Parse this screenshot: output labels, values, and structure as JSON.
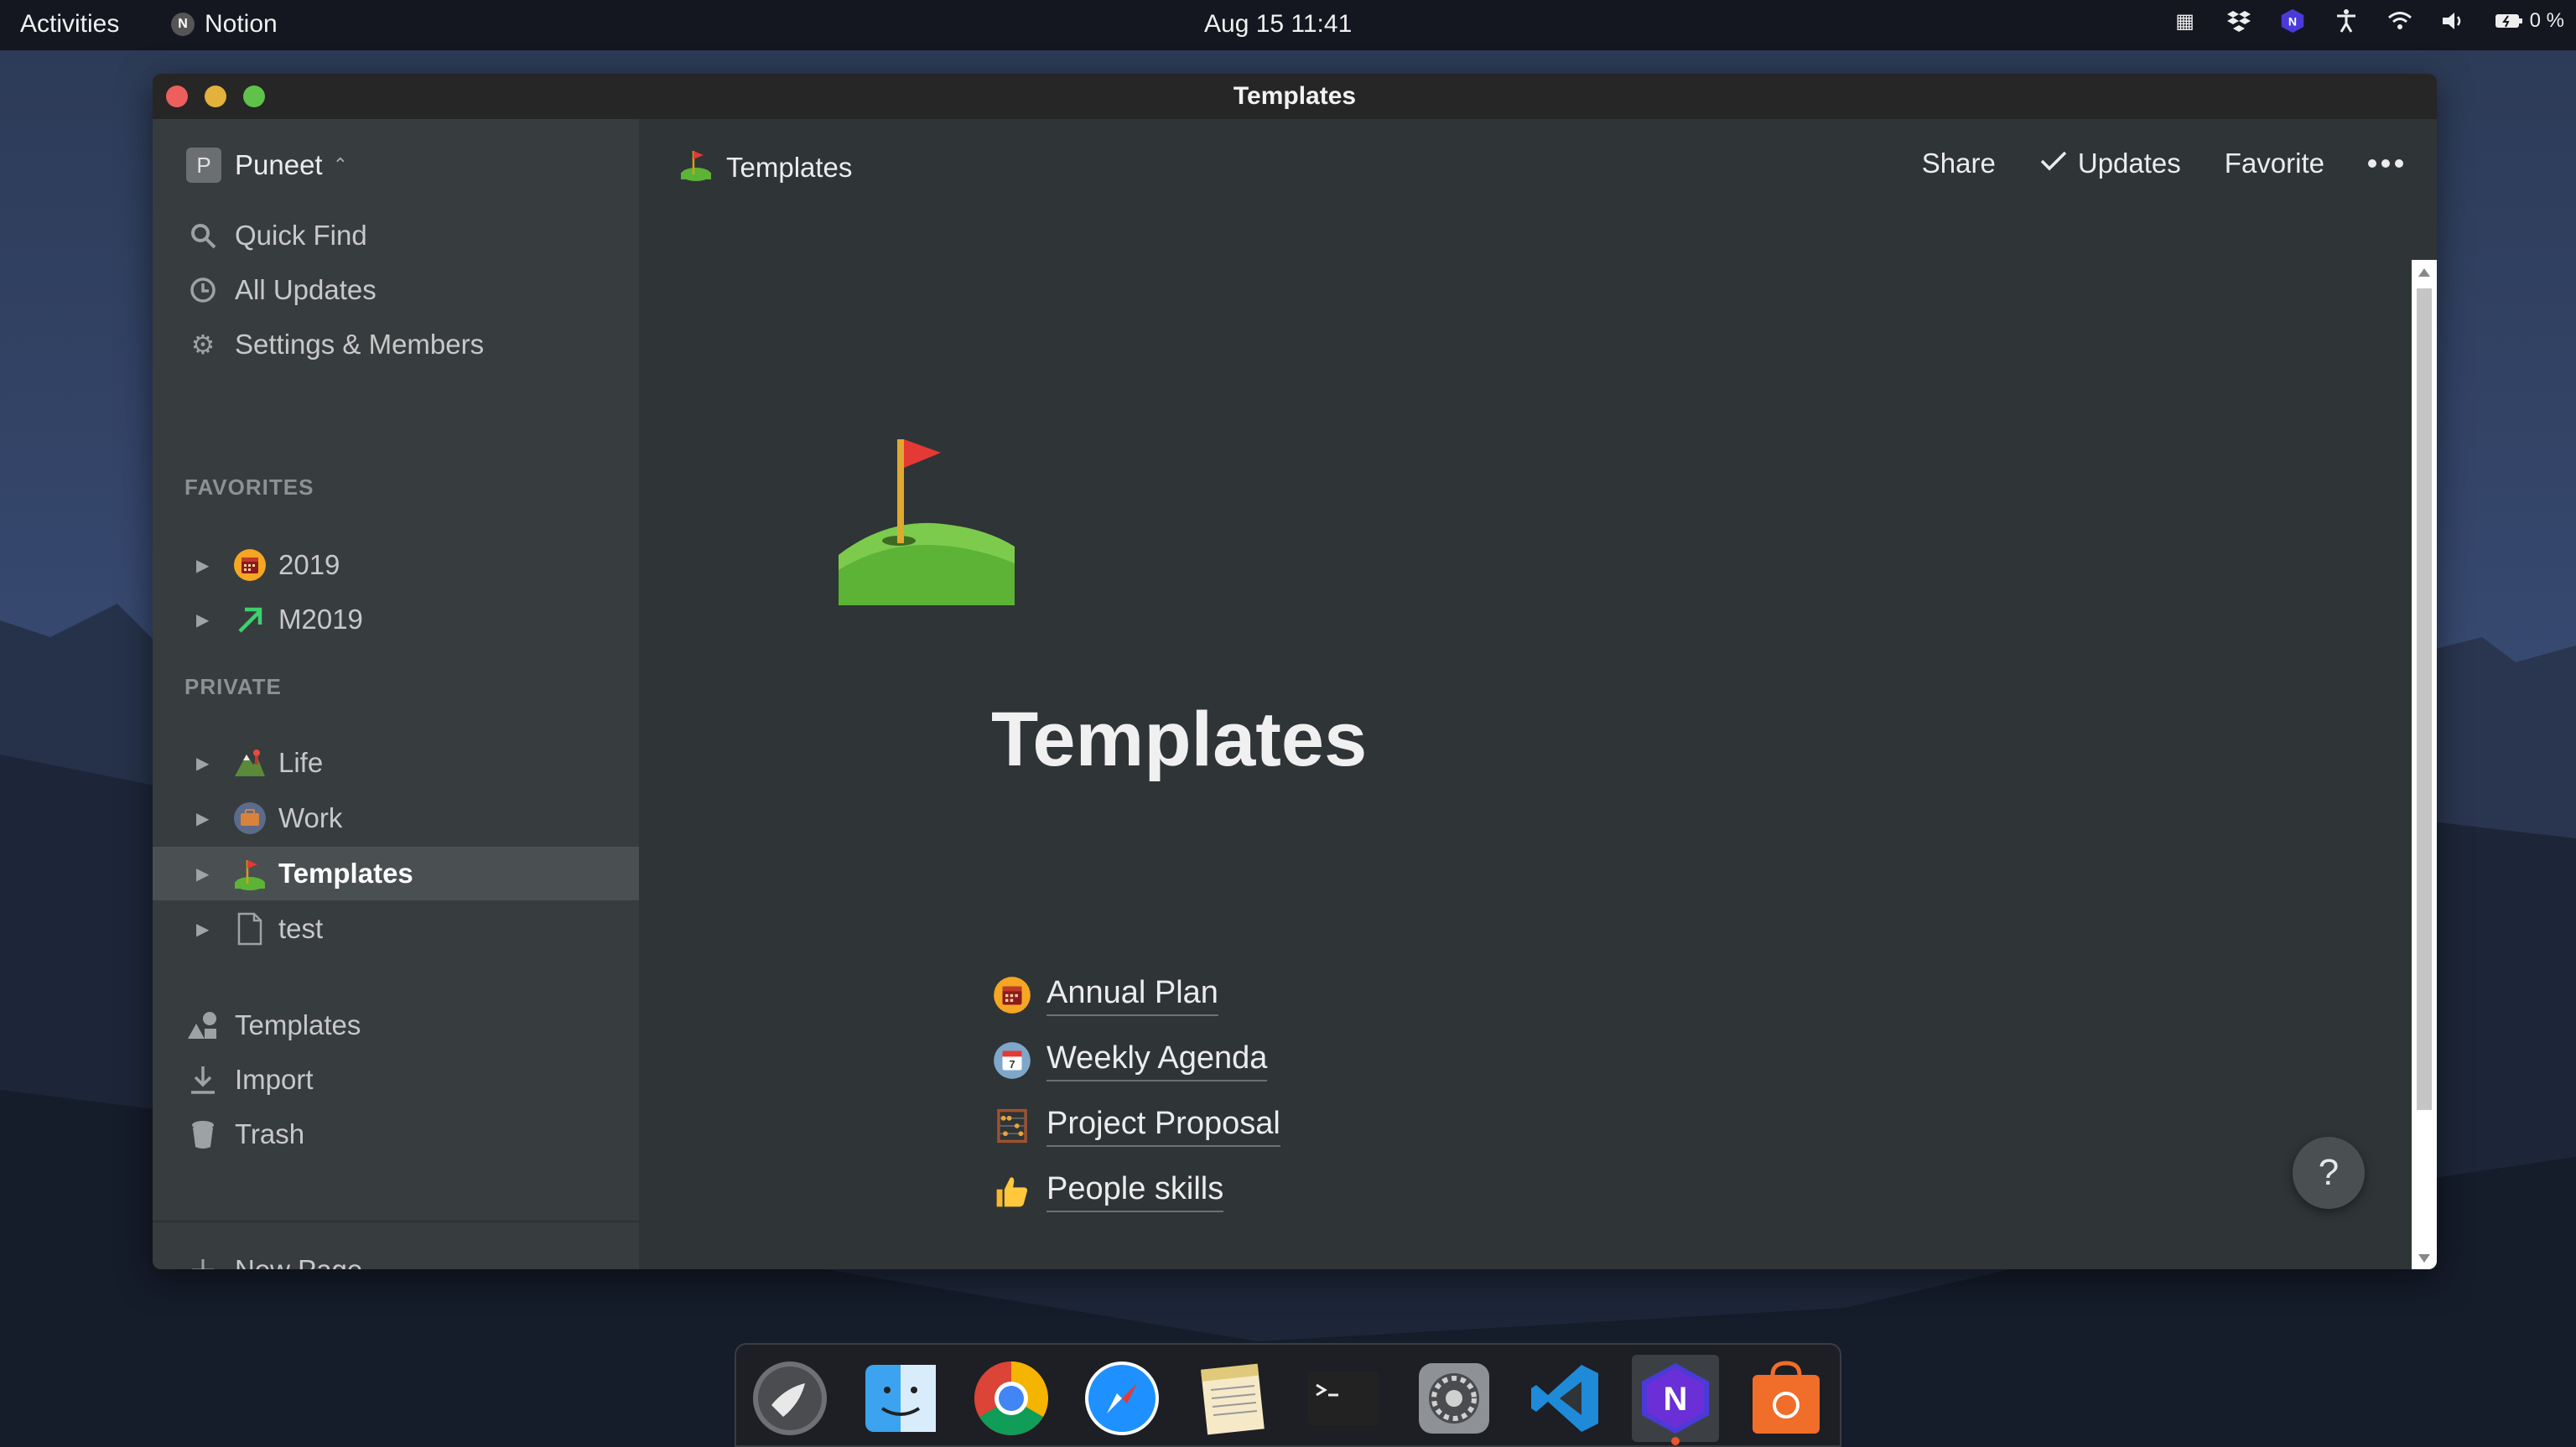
{
  "topbar": {
    "activities": "Activities",
    "app_name": "Notion",
    "app_icon_letter": "N",
    "clock": "Aug 15  11:41",
    "battery": "0 %",
    "tray_icons": [
      "grid-icon",
      "dropbox-icon",
      "notion-tray-icon",
      "accessibility-icon",
      "wifi-icon",
      "volume-icon",
      "battery-icon"
    ]
  },
  "window": {
    "title": "Templates"
  },
  "sidebar": {
    "workspace": {
      "avatar": "P",
      "name": "Puneet"
    },
    "top_items": [
      {
        "label": "Quick Find",
        "icon": "search-icon"
      },
      {
        "label": "All Updates",
        "icon": "clock-icon"
      },
      {
        "label": "Settings & Members",
        "icon": "gear-icon"
      }
    ],
    "favorites_label": "FAVORITES",
    "favorites": [
      {
        "label": "2019",
        "icon": "calendar-emoji"
      },
      {
        "label": "M2019",
        "icon": "arrow-up-right-icon"
      }
    ],
    "private_label": "PRIVATE",
    "private": [
      {
        "label": "Life",
        "icon": "mountain-emoji"
      },
      {
        "label": "Work",
        "icon": "briefcase-emoji"
      },
      {
        "label": "Templates",
        "icon": "golf-flag-emoji"
      },
      {
        "label": "test",
        "icon": "page-icon"
      }
    ],
    "bottom_items": [
      {
        "label": "Templates",
        "icon": "shapes-icon"
      },
      {
        "label": "Import",
        "icon": "download-icon"
      },
      {
        "label": "Trash",
        "icon": "trash-icon"
      }
    ],
    "new_page": "New Page"
  },
  "main": {
    "breadcrumb": "Templates",
    "actions": {
      "share": "Share",
      "updates": "Updates",
      "favorite": "Favorite"
    },
    "page_title": "Templates",
    "links": [
      {
        "label": "Annual Plan",
        "icon": "calendar-emoji"
      },
      {
        "label": "Weekly Agenda",
        "icon": "date-emoji"
      },
      {
        "label": "Project Proposal",
        "icon": "abacus-emoji"
      },
      {
        "label": "People skills",
        "icon": "thumbs-up-emoji"
      }
    ],
    "help": "?"
  },
  "dock": {
    "apps": [
      "launchpad-icon",
      "finder-icon",
      "chrome-icon",
      "safari-icon",
      "notes-icon",
      "terminal-icon",
      "settings-icon",
      "vscode-icon",
      "notion-icon",
      "software-store-icon"
    ]
  }
}
